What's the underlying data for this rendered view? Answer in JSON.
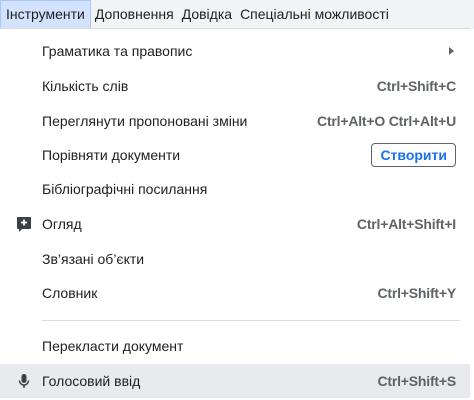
{
  "menubar": {
    "items": [
      "Інструменти",
      "Доповнення",
      "Довідка",
      "Спеціальні можливості"
    ]
  },
  "menu": {
    "items": [
      {
        "label": "Граматика та правопис",
        "submenu": true
      },
      {
        "label": "Кількість слів",
        "shortcut": "Ctrl+Shift+C"
      },
      {
        "label": "Переглянути пропоновані зміни",
        "shortcut": "Ctrl+Alt+O Ctrl+Alt+U"
      },
      {
        "label": "Порівняти документи",
        "button": "Створити"
      },
      {
        "label": "Бібліографічні посилання"
      },
      {
        "label": "Огляд",
        "shortcut": "Ctrl+Alt+Shift+I",
        "icon": "explore-plus-icon"
      },
      {
        "label": "Зв’язані об’єкти"
      },
      {
        "label": "Словник",
        "shortcut": "Ctrl+Shift+Y"
      },
      {
        "label": "Перекласти документ"
      },
      {
        "label": "Голосовий ввід",
        "shortcut": "Ctrl+Shift+S",
        "icon": "microphone-icon"
      }
    ]
  }
}
